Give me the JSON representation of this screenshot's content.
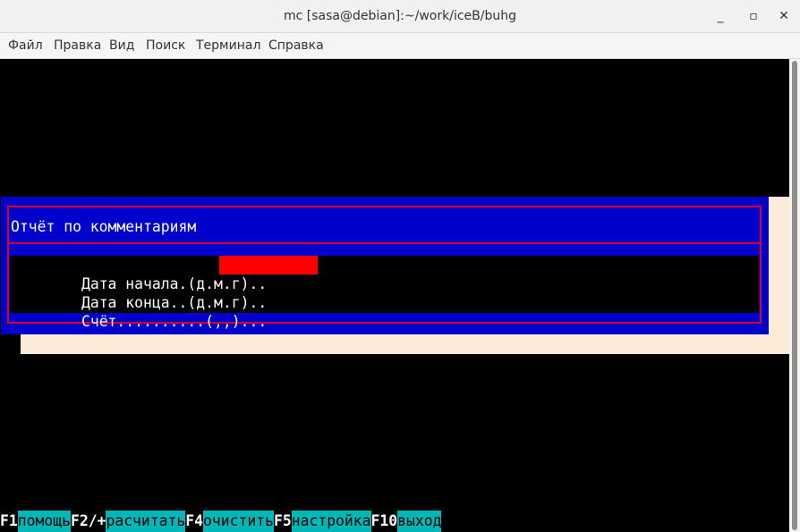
{
  "window": {
    "title": "mc [sasa@debian]:~/work/iceB/buhg",
    "minimize_icon": "minimize-icon",
    "maximize_icon": "maximize-icon",
    "close_icon": "close-icon"
  },
  "menu": {
    "items": [
      "Файл",
      "Правка",
      "Вид",
      "Поиск",
      "Терминал",
      "Справка"
    ]
  },
  "dialog": {
    "title": "Отчёт по комментариям",
    "fields": [
      {
        "label": "Дата начала.(д.м.г)..",
        "value": ""
      },
      {
        "label": "Дата конца..(д.м.г)..",
        "value": ""
      },
      {
        "label": "Счёт..........(,,)...",
        "value": ""
      }
    ],
    "colors": {
      "background": "#0000cc",
      "frame": "#d4002a",
      "active_input": "#ff0000",
      "shadow": "#fcebd8"
    }
  },
  "function_keys": [
    {
      "key": "F1",
      "label": "помощь"
    },
    {
      "key": "F2/+",
      "label": "расчитать"
    },
    {
      "key": "F4",
      "label": "очистить"
    },
    {
      "key": "F5",
      "label": "настройка"
    },
    {
      "key": "F10",
      "label": "выход"
    }
  ],
  "fkey_label_color": "#00b7b7"
}
